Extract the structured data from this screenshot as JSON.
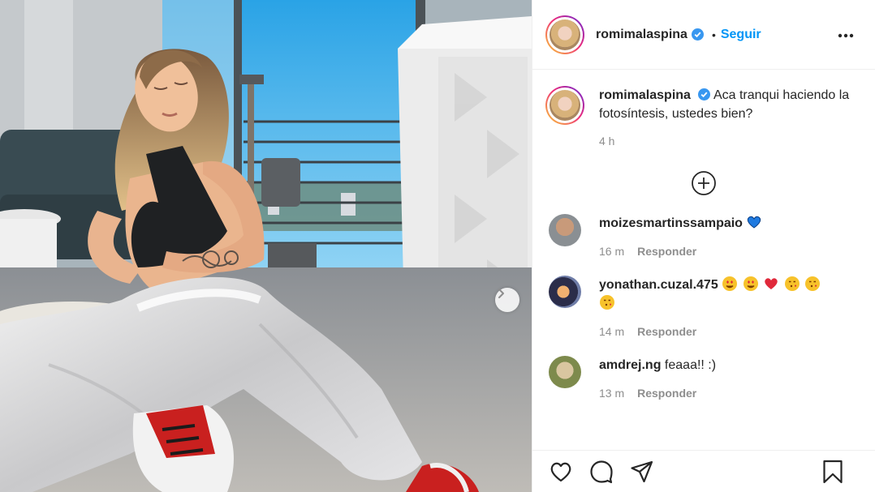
{
  "post": {
    "author": "romimalaspina",
    "follow_label": "Seguir",
    "separator": "•",
    "caption": "Aca tranqui haciendo la fotosíntesis, ustedes bien?",
    "caption_time": "4 h",
    "verified_color": "#3897f0",
    "follow_color": "#0095f6"
  },
  "comments": [
    {
      "user": "moizesmartinssampaio",
      "text": "",
      "emojis": [
        "blue-heart"
      ],
      "time": "16 m",
      "reply_label": "Responder"
    },
    {
      "user": "yonathan.cuzal.475",
      "text": "",
      "emojis": [
        "heart-eyes",
        "heart-eyes",
        "red-heart",
        "kiss",
        "kiss",
        "kiss"
      ],
      "time": "14 m",
      "reply_label": "Responder"
    },
    {
      "user": "amdrej.ng",
      "text": "feaaa!! :)",
      "emojis": [],
      "time": "13 m",
      "reply_label": "Responder"
    }
  ],
  "icons": {
    "like": "heart-outline-icon",
    "comment": "comment-bubble-icon",
    "share": "paper-plane-icon",
    "save": "bookmark-icon",
    "more": "more-options-icon",
    "load_more": "plus-circle-icon",
    "next": "chevron-right-icon"
  }
}
